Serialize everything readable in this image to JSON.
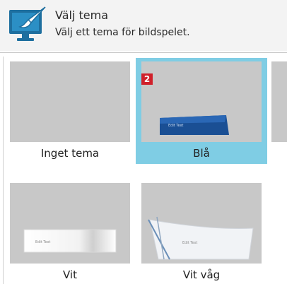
{
  "header": {
    "title": "Välj tema",
    "subtitle": "Välj ett tema för bildspelet.",
    "icon": "paintbrush-monitor-icon"
  },
  "badge": "2",
  "themes": [
    {
      "label": "Inget tema",
      "selected": false
    },
    {
      "label": "Blå",
      "selected": true,
      "sample_text": "Edit Text"
    },
    {
      "label": "Vit",
      "selected": false,
      "sample_text": "Edit Text"
    },
    {
      "label": "Vit våg",
      "selected": false,
      "sample_text": "Edit Text"
    }
  ],
  "colors": {
    "selected_highlight": "#7fcde4",
    "thumbnail_gray": "#c8c8c8",
    "badge_red": "#d0202a",
    "icon_blue": "#1e6f9f"
  }
}
